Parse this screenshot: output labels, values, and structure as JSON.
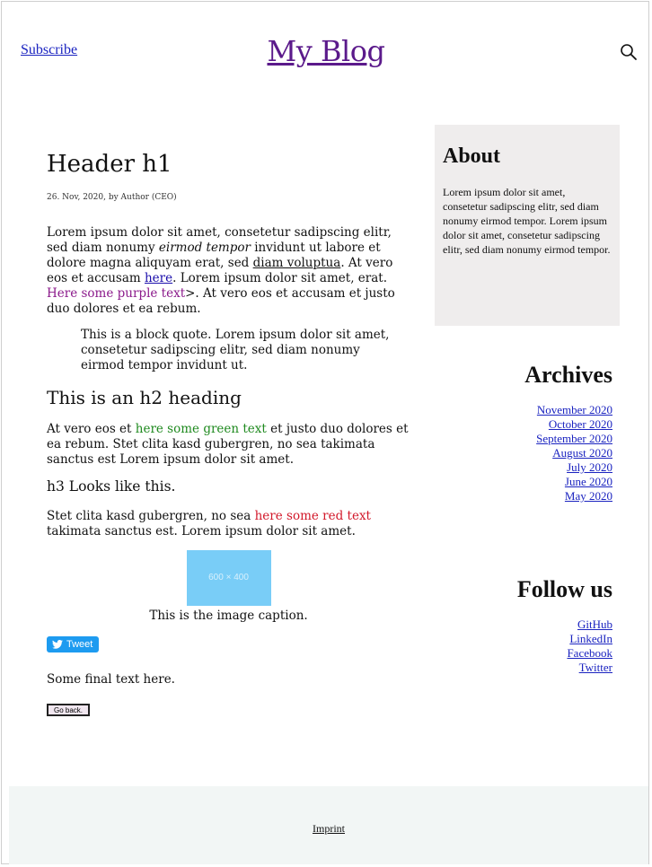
{
  "header": {
    "subscribe_label": "Subscribe",
    "blog_title": "My Blog",
    "search_icon": "search-icon"
  },
  "post": {
    "title": "Header h1",
    "meta": "26. Nov, 2020, by Author (CEO)",
    "p1": {
      "t1": "Lorem ipsum dolor sit amet, consetetur sadipscing elitr, sed diam nonumy ",
      "italic": "eirmod tempor",
      "t2": " invidunt ut labore et dolore magna aliquyam erat, sed ",
      "underline": "diam voluptua",
      "t3": ". At vero eos et accusam ",
      "link": "here",
      "t4": ". Lorem ipsum dolor sit amet, erat. ",
      "purple": "Here some purple text",
      "t5": ">. At vero eos et accusam et justo duo dolores et ea rebum."
    },
    "blockquote": "This is a block quote. Lorem ipsum dolor sit amet, consetetur sadipscing elitr, sed diam nonumy eirmod tempor invidunt ut.",
    "h2": "This is an h2 heading",
    "p2": {
      "t1": "At vero eos et ",
      "green": "here some green text",
      "t2": " et justo duo dolores et ea rebum. Stet clita kasd gubergren, no sea takimata sanctus est Lorem ipsum dolor sit amet."
    },
    "h3": "h3 Looks like this.",
    "p3": {
      "t1": "Stet clita kasd gubergren, no sea ",
      "red": "here some red text",
      "t2": " takimata sanctus est. Lorem ipsum dolor sit amet."
    },
    "image_placeholder": "600 × 400",
    "caption": "This is the image caption.",
    "tweet_label": "Tweet",
    "final_text": "Some final text here.",
    "go_back_label": "Go back."
  },
  "sidebar": {
    "about": {
      "heading": "About",
      "text": "Lorem ipsum dolor sit amet, consetetur sadipscing elitr, sed diam nonumy eirmod tempor. Lorem ipsum dolor sit amet, consetetur sadipscing elitr, sed diam nonumy eirmod tempor."
    },
    "archives": {
      "heading": "Archives",
      "items": [
        "November 2020",
        "October 2020",
        "September 2020",
        "August 2020",
        "July 2020",
        "June 2020",
        "May 2020"
      ]
    },
    "follow": {
      "heading": "Follow us",
      "items": [
        "GitHub",
        "LinkedIn",
        "Facebook",
        "Twitter"
      ]
    }
  },
  "footer": {
    "imprint_label": "Imprint"
  },
  "colors": {
    "title": "#5b1a8b",
    "link": "#1a23c0",
    "purple_text": "#8b1a8b",
    "green_text": "#1f8a1f",
    "red_text": "#d2182a",
    "tweet_button": "#1d9bf0",
    "about_bg": "#efeded",
    "footer_bg": "#f2f6f5"
  }
}
